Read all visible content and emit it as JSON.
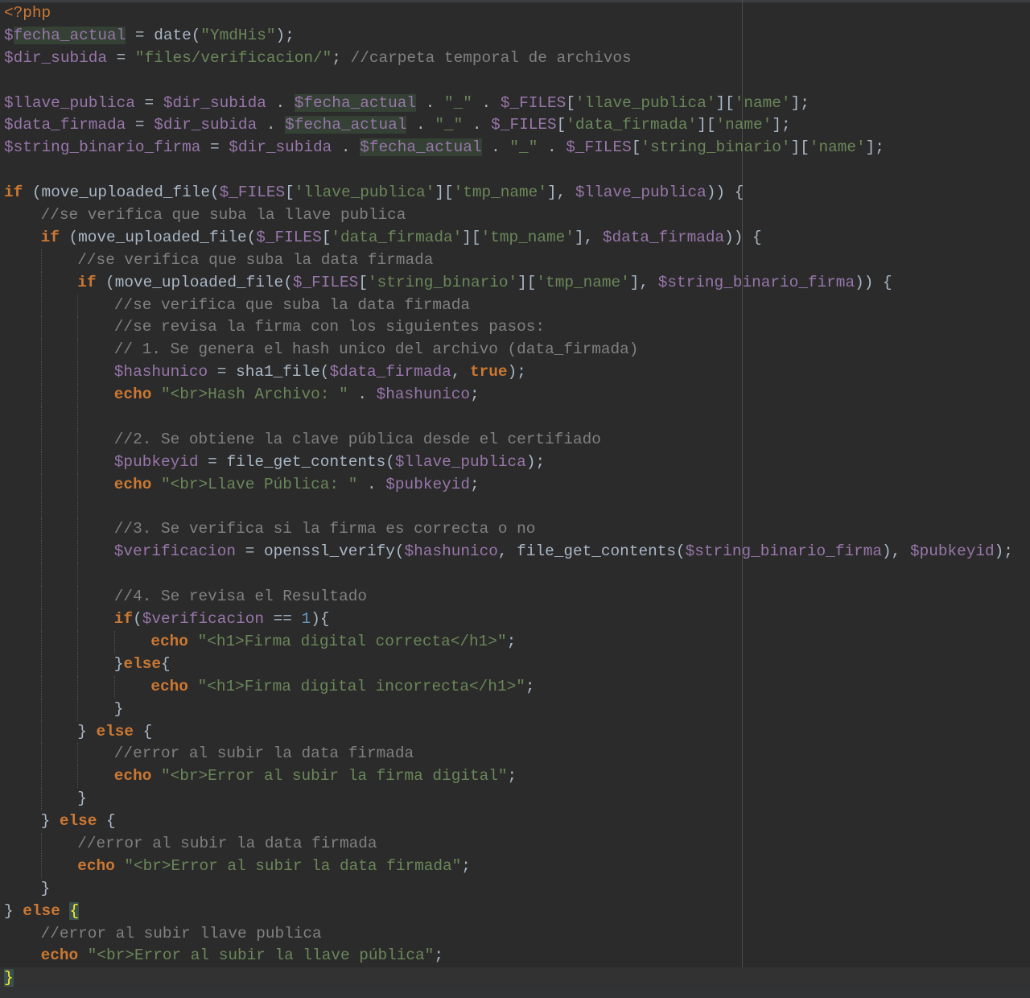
{
  "editor": {
    "language": "php",
    "colors": {
      "background": "#2b2b2b",
      "keyword": "#cc7832",
      "variable": "#9876aa",
      "string": "#6a8759",
      "comment": "#808080",
      "text": "#a9b7c6",
      "number": "#6897bb"
    },
    "lines": [
      {
        "indent": 0,
        "tokens": [
          [
            "tag",
            "<?php"
          ]
        ]
      },
      {
        "indent": 0,
        "tokens": [
          [
            "var",
            "$"
          ],
          [
            "varhl",
            "fecha_actual"
          ],
          [
            "op",
            " = date("
          ],
          [
            "str",
            "\"YmdHis\""
          ],
          [
            "op",
            ");"
          ]
        ]
      },
      {
        "indent": 0,
        "tokens": [
          [
            "var",
            "$dir_subida"
          ],
          [
            "op",
            " = "
          ],
          [
            "str",
            "\"files/verificacion/\""
          ],
          [
            "op",
            "; "
          ],
          [
            "cmt",
            "//carpeta temporal de archivos"
          ]
        ]
      },
      {
        "indent": 0,
        "tokens": []
      },
      {
        "indent": 0,
        "tokens": [
          [
            "var",
            "$llave_publica"
          ],
          [
            "op",
            " = "
          ],
          [
            "var",
            "$dir_subida"
          ],
          [
            "op",
            " . "
          ],
          [
            "varhl",
            "$fecha_actual"
          ],
          [
            "op",
            " . "
          ],
          [
            "str",
            "\"_\""
          ],
          [
            "op",
            " . "
          ],
          [
            "var",
            "$_FILES"
          ],
          [
            "op",
            "["
          ],
          [
            "str",
            "'llave_publica'"
          ],
          [
            "op",
            "]["
          ],
          [
            "str",
            "'name'"
          ],
          [
            "op",
            "];"
          ]
        ]
      },
      {
        "indent": 0,
        "tokens": [
          [
            "var",
            "$data_firmada"
          ],
          [
            "op",
            " = "
          ],
          [
            "var",
            "$dir_subida"
          ],
          [
            "op",
            " . "
          ],
          [
            "varhl",
            "$fecha_actual"
          ],
          [
            "op",
            " . "
          ],
          [
            "str",
            "\"_\""
          ],
          [
            "op",
            " . "
          ],
          [
            "var",
            "$_FILES"
          ],
          [
            "op",
            "["
          ],
          [
            "str",
            "'data_firmada'"
          ],
          [
            "op",
            "]["
          ],
          [
            "str",
            "'name'"
          ],
          [
            "op",
            "];"
          ]
        ]
      },
      {
        "indent": 0,
        "tokens": [
          [
            "var",
            "$string_binario_firma"
          ],
          [
            "op",
            " = "
          ],
          [
            "var",
            "$dir_subida"
          ],
          [
            "op",
            " . "
          ],
          [
            "varhl",
            "$fecha_actual"
          ],
          [
            "op",
            " . "
          ],
          [
            "str",
            "\"_\""
          ],
          [
            "op",
            " . "
          ],
          [
            "var",
            "$_FILES"
          ],
          [
            "op",
            "["
          ],
          [
            "str",
            "'string_binario'"
          ],
          [
            "op",
            "]["
          ],
          [
            "str",
            "'name'"
          ],
          [
            "op",
            "];"
          ]
        ]
      },
      {
        "indent": 0,
        "tokens": []
      },
      {
        "indent": 0,
        "tokens": [
          [
            "kw",
            "if"
          ],
          [
            "op",
            " (move_uploaded_file("
          ],
          [
            "var",
            "$_FILES"
          ],
          [
            "op",
            "["
          ],
          [
            "str",
            "'llave_publica'"
          ],
          [
            "op",
            "]["
          ],
          [
            "str",
            "'tmp_name'"
          ],
          [
            "op",
            "], "
          ],
          [
            "var",
            "$llave_publica"
          ],
          [
            "op",
            ")) {"
          ]
        ]
      },
      {
        "indent": 1,
        "tokens": [
          [
            "cmt",
            "//se verifica que suba la llave publica"
          ]
        ]
      },
      {
        "indent": 1,
        "tokens": [
          [
            "kw",
            "if"
          ],
          [
            "op",
            " (move_uploaded_file("
          ],
          [
            "var",
            "$_FILES"
          ],
          [
            "op",
            "["
          ],
          [
            "str",
            "'data_firmada'"
          ],
          [
            "op",
            "]["
          ],
          [
            "str",
            "'tmp_name'"
          ],
          [
            "op",
            "], "
          ],
          [
            "var",
            "$data_firmada"
          ],
          [
            "op",
            ")) {"
          ]
        ]
      },
      {
        "indent": 2,
        "tokens": [
          [
            "cmt",
            "//se verifica que suba la data firmada"
          ]
        ]
      },
      {
        "indent": 2,
        "tokens": [
          [
            "kw",
            "if"
          ],
          [
            "op",
            " (move_uploaded_file("
          ],
          [
            "var",
            "$_FILES"
          ],
          [
            "op",
            "["
          ],
          [
            "str",
            "'string_binario'"
          ],
          [
            "op",
            "]["
          ],
          [
            "str",
            "'tmp_name'"
          ],
          [
            "op",
            "], "
          ],
          [
            "var",
            "$string_binario_firma"
          ],
          [
            "op",
            ")) {"
          ]
        ]
      },
      {
        "indent": 3,
        "tokens": [
          [
            "cmt",
            "//se verifica que suba la data firmada"
          ]
        ]
      },
      {
        "indent": 3,
        "tokens": [
          [
            "cmt",
            "//se revisa la firma con los siguientes pasos:"
          ]
        ]
      },
      {
        "indent": 3,
        "tokens": [
          [
            "cmt",
            "// 1. Se genera el hash unico del archivo (data_firmada)"
          ]
        ]
      },
      {
        "indent": 3,
        "tokens": [
          [
            "var",
            "$hashunico"
          ],
          [
            "op",
            " = sha1_file("
          ],
          [
            "var",
            "$data_firmada"
          ],
          [
            "op",
            ", "
          ],
          [
            "kw",
            "true"
          ],
          [
            "op",
            ");"
          ]
        ]
      },
      {
        "indent": 3,
        "tokens": [
          [
            "kw",
            "echo"
          ],
          [
            "op",
            " "
          ],
          [
            "str",
            "\"<br>Hash Archivo: \""
          ],
          [
            "op",
            " . "
          ],
          [
            "var",
            "$hashunico"
          ],
          [
            "op",
            ";"
          ]
        ]
      },
      {
        "indent": 3,
        "tokens": []
      },
      {
        "indent": 3,
        "tokens": [
          [
            "cmt",
            "//2. Se obtiene la clave pública desde el certifiado"
          ]
        ]
      },
      {
        "indent": 3,
        "tokens": [
          [
            "var",
            "$pubkeyid"
          ],
          [
            "op",
            " = file_get_contents("
          ],
          [
            "var",
            "$llave_publica"
          ],
          [
            "op",
            ");"
          ]
        ]
      },
      {
        "indent": 3,
        "tokens": [
          [
            "kw",
            "echo"
          ],
          [
            "op",
            " "
          ],
          [
            "str",
            "\"<br>Llave Pública: \""
          ],
          [
            "op",
            " . "
          ],
          [
            "var",
            "$pubkeyid"
          ],
          [
            "op",
            ";"
          ]
        ]
      },
      {
        "indent": 3,
        "tokens": []
      },
      {
        "indent": 3,
        "tokens": [
          [
            "cmt",
            "//3. Se verifica si la firma es correcta o no"
          ]
        ]
      },
      {
        "indent": 3,
        "tokens": [
          [
            "var",
            "$verificacion"
          ],
          [
            "op",
            " = openssl_verify("
          ],
          [
            "var",
            "$hashunico"
          ],
          [
            "op",
            ", file_get_contents("
          ],
          [
            "var",
            "$string_binario_firma"
          ],
          [
            "op",
            "), "
          ],
          [
            "var",
            "$pubkeyid"
          ],
          [
            "op",
            ");"
          ]
        ]
      },
      {
        "indent": 3,
        "tokens": []
      },
      {
        "indent": 3,
        "tokens": [
          [
            "cmt",
            "//4. Se revisa el Resultado"
          ]
        ]
      },
      {
        "indent": 3,
        "tokens": [
          [
            "kw",
            "if"
          ],
          [
            "op",
            "("
          ],
          [
            "var",
            "$verificacion"
          ],
          [
            "op",
            " == "
          ],
          [
            "num",
            "1"
          ],
          [
            "op",
            "){"
          ]
        ]
      },
      {
        "indent": 4,
        "tokens": [
          [
            "kw",
            "echo"
          ],
          [
            "op",
            " "
          ],
          [
            "str",
            "\"<h1>Firma digital correcta</h1>\""
          ],
          [
            "op",
            ";"
          ]
        ]
      },
      {
        "indent": 3,
        "tokens": [
          [
            "op",
            "}"
          ],
          [
            "kw",
            "else"
          ],
          [
            "op",
            "{"
          ]
        ]
      },
      {
        "indent": 4,
        "tokens": [
          [
            "kw",
            "echo"
          ],
          [
            "op",
            " "
          ],
          [
            "str",
            "\"<h1>Firma digital incorrecta</h1>\""
          ],
          [
            "op",
            ";"
          ]
        ]
      },
      {
        "indent": 3,
        "tokens": [
          [
            "op",
            "}"
          ]
        ]
      },
      {
        "indent": 2,
        "tokens": [
          [
            "op",
            "} "
          ],
          [
            "kw",
            "else"
          ],
          [
            "op",
            " {"
          ]
        ]
      },
      {
        "indent": 3,
        "tokens": [
          [
            "cmt",
            "//error al subir la data firmada"
          ]
        ]
      },
      {
        "indent": 3,
        "tokens": [
          [
            "kw",
            "echo"
          ],
          [
            "op",
            " "
          ],
          [
            "str",
            "\"<br>Error al subir la firma digital\""
          ],
          [
            "op",
            ";"
          ]
        ]
      },
      {
        "indent": 2,
        "tokens": [
          [
            "op",
            "}"
          ]
        ]
      },
      {
        "indent": 1,
        "tokens": [
          [
            "op",
            "} "
          ],
          [
            "kw",
            "else"
          ],
          [
            "op",
            " {"
          ]
        ]
      },
      {
        "indent": 2,
        "tokens": [
          [
            "cmt",
            "//error al subir la data firmada"
          ]
        ]
      },
      {
        "indent": 2,
        "tokens": [
          [
            "kw",
            "echo"
          ],
          [
            "op",
            " "
          ],
          [
            "str",
            "\"<br>Error al subir la data firmada\""
          ],
          [
            "op",
            ";"
          ]
        ]
      },
      {
        "indent": 1,
        "tokens": [
          [
            "op",
            "}"
          ]
        ]
      },
      {
        "indent": 0,
        "tokens": [
          [
            "op",
            "} "
          ],
          [
            "kw",
            "else"
          ],
          [
            "op",
            " "
          ],
          [
            "bracehl",
            "{"
          ]
        ]
      },
      {
        "indent": 1,
        "tokens": [
          [
            "cmt",
            "//error al subir llave publica"
          ]
        ]
      },
      {
        "indent": 1,
        "tokens": [
          [
            "kw",
            "echo"
          ],
          [
            "op",
            " "
          ],
          [
            "str",
            "\"<br>Error al subir la llave pública\""
          ],
          [
            "op",
            ";"
          ]
        ]
      },
      {
        "indent": 0,
        "caret": true,
        "tokens": [
          [
            "bracehl",
            "}"
          ]
        ]
      }
    ]
  }
}
